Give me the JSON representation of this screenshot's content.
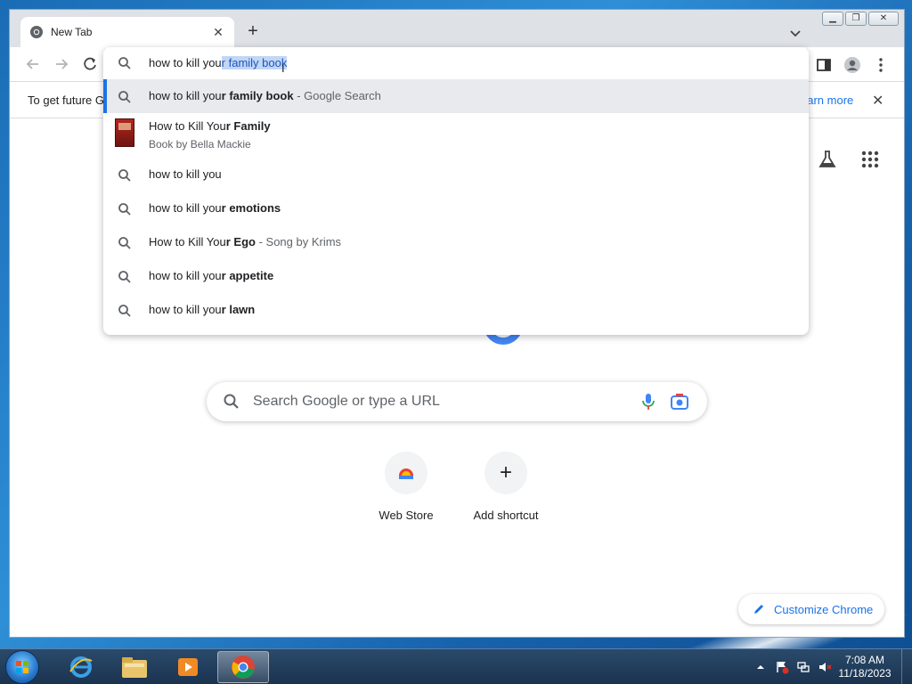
{
  "browser": {
    "tab_title": "New Tab",
    "omnibox_typed": "how to kill you",
    "omnibox_selected": "r family book",
    "infobar_text": "To get future G",
    "infobar_link": "earn more"
  },
  "suggestions": [
    {
      "prefix": "how to kill you",
      "bold": "r family book",
      "suffix": " - Google Search"
    },
    {
      "prefix": "How to Kill You",
      "bold": "r Family",
      "subtitle": "Book by Bella Mackie"
    },
    {
      "prefix": "how to kill you",
      "bold": "",
      "suffix": ""
    },
    {
      "prefix": "how to kill you",
      "bold": "r emotions",
      "suffix": ""
    },
    {
      "prefix": "How to Kill You",
      "bold": "r Ego",
      "suffix": " - Song by Krims"
    },
    {
      "prefix": "how to kill you",
      "bold": "r appetite",
      "suffix": ""
    },
    {
      "prefix": "how to kill you",
      "bold": "r lawn",
      "suffix": ""
    }
  ],
  "ntp": {
    "search_placeholder": "Search Google or type a URL",
    "shortcuts": [
      {
        "label": "Web Store"
      },
      {
        "label": "Add shortcut"
      }
    ],
    "customize_label": "Customize Chrome"
  },
  "taskbar": {
    "time": "7:08 AM",
    "date": "11/18/2023"
  },
  "colors": {
    "accent": "#1a73e8",
    "selection": "#c2d6f5",
    "active_row": "#e8eaed"
  }
}
